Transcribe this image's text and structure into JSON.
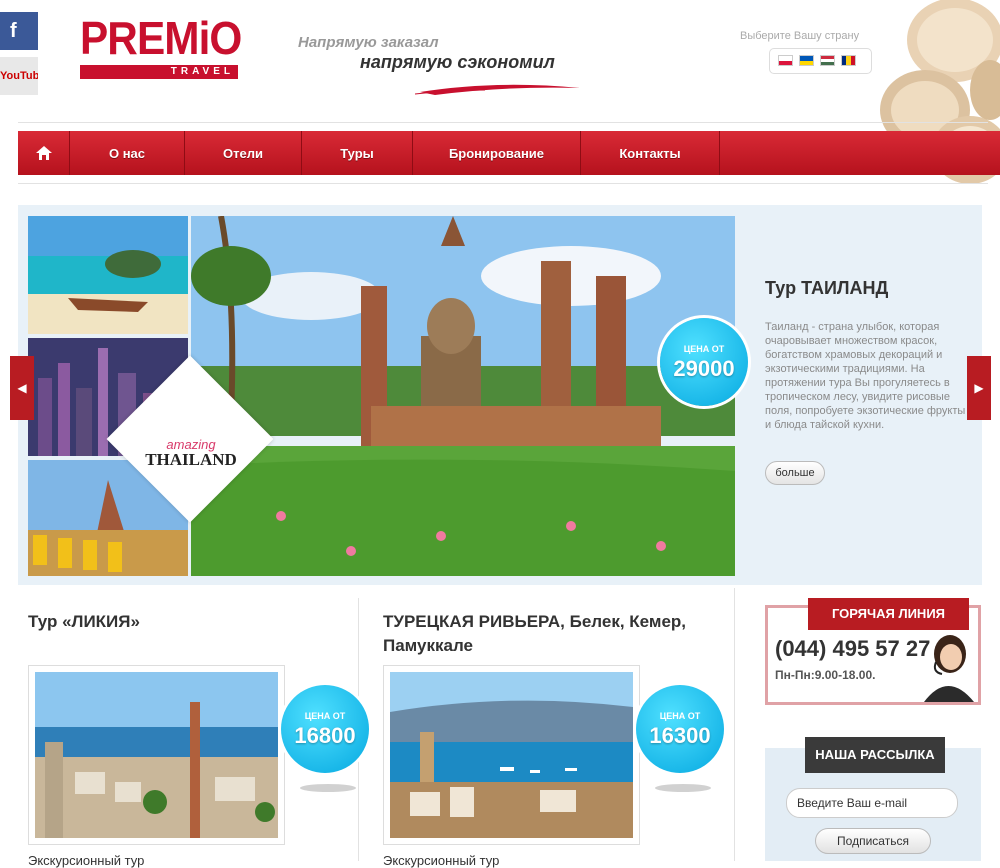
{
  "social": {
    "facebook": "f",
    "youtube": "YouTube"
  },
  "logo": {
    "main": "PREMiO",
    "sub": "TRAVEL"
  },
  "slogan": {
    "line1": "Напрямую заказал",
    "line2": "напрямую сэкономил"
  },
  "country": {
    "label": "Выберите Вашу страну",
    "flags": [
      "Poland",
      "Ukraine",
      "Hungary",
      "Romania"
    ]
  },
  "nav": {
    "items": [
      {
        "label": "",
        "icon": "home-icon"
      },
      {
        "label": "О нас"
      },
      {
        "label": "Отели"
      },
      {
        "label": "Туры"
      },
      {
        "label": "Бронирование"
      },
      {
        "label": "Контакты"
      }
    ]
  },
  "slider": {
    "title": "Тур ТАИЛАНД",
    "description": "Таиланд - страна улыбок, которая очаровывает множеством красок, богатством храмовых декораций и экзотическими традициями. На протяжении тура Вы прогуляетесь в тропическом лесу, увидите рисовые поля, попробуете экзотические фрукты и блюда тайской кухни.",
    "more_label": "больше",
    "price_label": "ЦЕНА ОТ",
    "price_value": "29000",
    "badge": {
      "amazing": "amazing",
      "country": "THAILAND"
    }
  },
  "tours": [
    {
      "title": "Тур «ЛИКИЯ»",
      "price_label": "ЦЕНА ОТ",
      "price_value": "16800",
      "subtitle": "Экскурсионный тур"
    },
    {
      "title": "ТУРЕЦКАЯ РИВЬЕРА, Белек, Кемер, Памуккале",
      "price_label": "ЦЕНА ОТ",
      "price_value": "16300",
      "subtitle": "Экскурсионный тур"
    }
  ],
  "hotline": {
    "title": "ГОРЯЧАЯ ЛИНИЯ",
    "phone": "(044) 495 57 27",
    "hours": "Пн-Пн:9.00-18.00."
  },
  "newsletter": {
    "title": "НАША РАССЫЛКА",
    "email_value": "Введите Ваш e-mail",
    "subscribe_label": "Подписаться"
  },
  "colors": {
    "brand_red": "#c8102e",
    "price_blue": "#05a8e0",
    "slider_bg": "#e8f1f8"
  }
}
